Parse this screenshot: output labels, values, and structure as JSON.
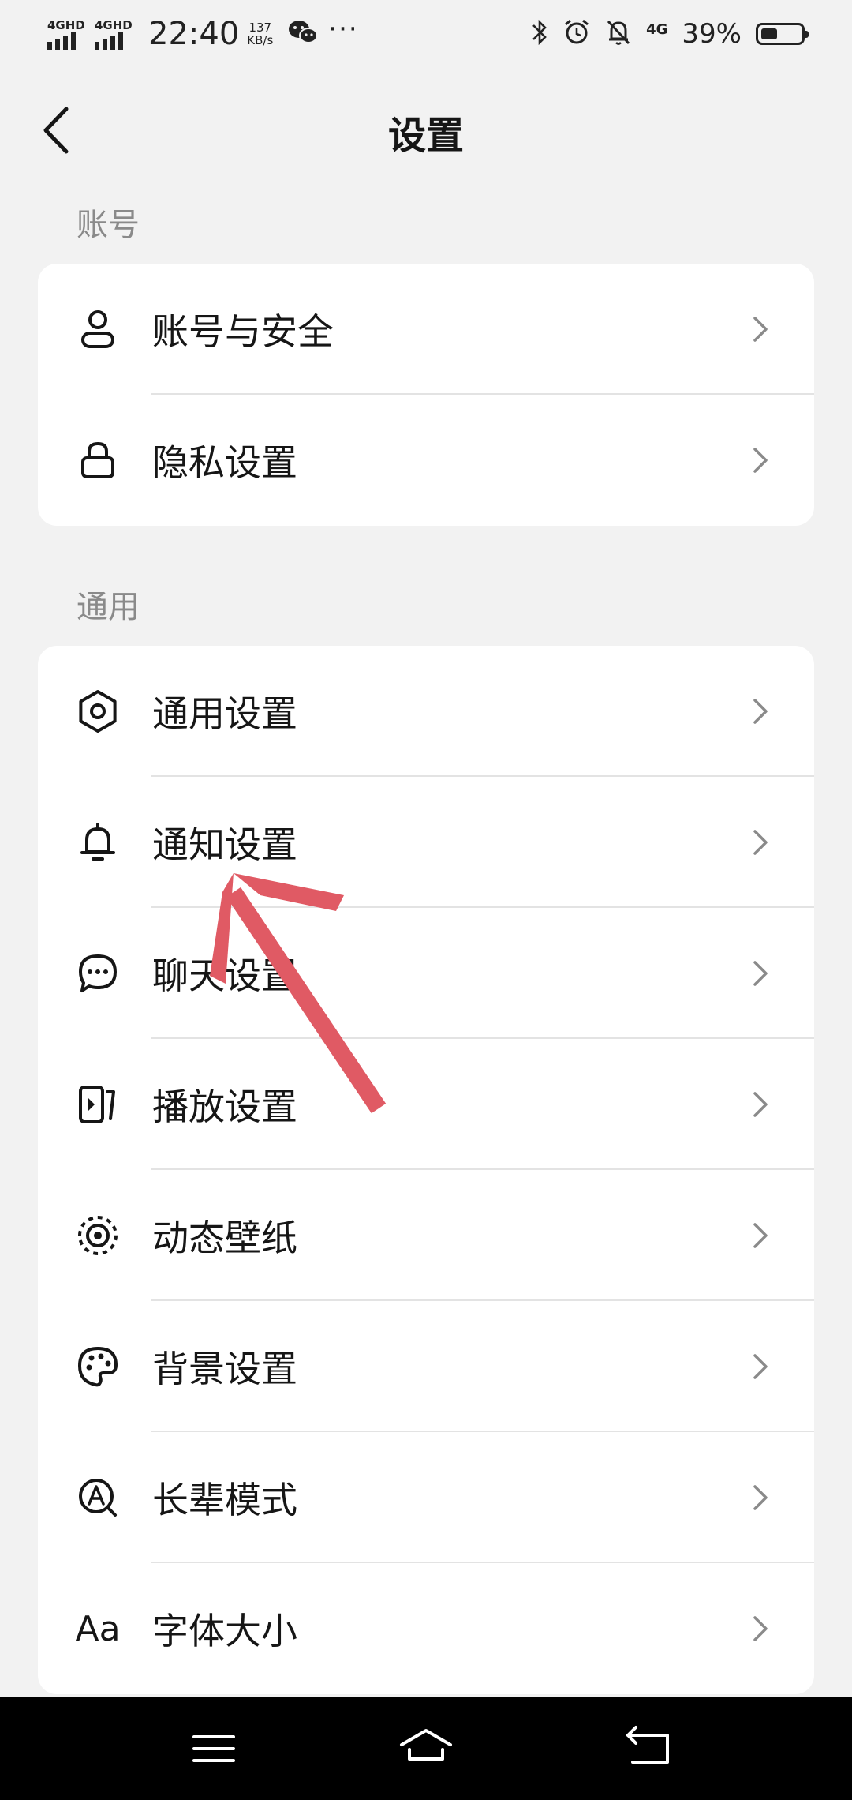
{
  "status_bar": {
    "signal1": "4GHD",
    "signal2": "4GHD",
    "time": "22:40",
    "speed_value": "137",
    "speed_unit": "KB/s",
    "more": "···",
    "net": "4G",
    "battery_pct": "39%",
    "battery_level": 0.39
  },
  "header": {
    "title": "设置"
  },
  "sections": [
    {
      "label": "账号",
      "items": [
        {
          "label": "账号与安全",
          "icon": "user-icon"
        },
        {
          "label": "隐私设置",
          "icon": "lock-icon"
        }
      ]
    },
    {
      "label": "通用",
      "items": [
        {
          "label": "通用设置",
          "icon": "gear-icon"
        },
        {
          "label": "通知设置",
          "icon": "bell-icon"
        },
        {
          "label": "聊天设置",
          "icon": "chat-bubble-icon"
        },
        {
          "label": "播放设置",
          "icon": "play-icon"
        },
        {
          "label": "动态壁纸",
          "icon": "live-wallpaper-icon"
        },
        {
          "label": "背景设置",
          "icon": "palette-icon"
        },
        {
          "label": "长辈模式",
          "icon": "elder-mode-icon"
        },
        {
          "label": "字体大小",
          "icon": "font-size-icon",
          "glyph": "Aa"
        }
      ]
    }
  ],
  "colors": {
    "background": "#f2f2f2",
    "card": "#ffffff",
    "annotation_arrow": "#e05a64",
    "navbar": "#000000"
  }
}
